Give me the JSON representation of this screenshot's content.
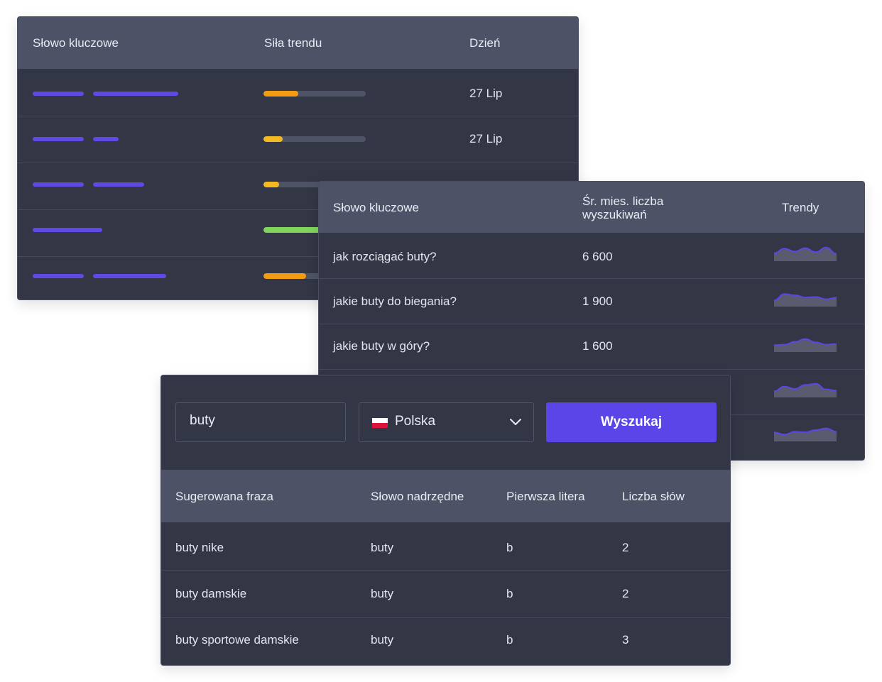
{
  "trend_table": {
    "headers": {
      "keyword": "Słowo kluczowe",
      "strength": "Siła trendu",
      "day": "Dzień"
    },
    "rows": [
      {
        "strength": 0.34,
        "color": "#f39c12",
        "day": "27 Lip"
      },
      {
        "strength": 0.19,
        "color": "#f5b921",
        "day": "27 Lip"
      },
      {
        "strength": 0.15,
        "color": "#f5b921",
        "day": ""
      },
      {
        "strength": 0.7,
        "color": "#7fd65a",
        "day": ""
      },
      {
        "strength": 0.42,
        "color": "#f39c12",
        "day": ""
      }
    ]
  },
  "volume_table": {
    "headers": {
      "keyword": "Słowo kluczowe",
      "volume_line1": "Śr. mies. liczba",
      "volume_line2": "wyszukiwań",
      "trends": "Trendy"
    },
    "rows": [
      {
        "keyword": "jak rozciągać buty?",
        "volume": "6 600",
        "trend": [
          0.45,
          0.85,
          0.6,
          0.9,
          0.55,
          0.95,
          0.4
        ]
      },
      {
        "keyword": "jakie buty do biegania?",
        "volume": "1 900",
        "trend": [
          0.3,
          0.85,
          0.75,
          0.55,
          0.6,
          0.4,
          0.55
        ]
      },
      {
        "keyword": "jakie buty w góry?",
        "volume": "1 600",
        "trend": [
          0.35,
          0.4,
          0.65,
          0.9,
          0.6,
          0.4,
          0.45
        ]
      },
      {
        "keyword": "",
        "volume": "",
        "trend": [
          0.3,
          0.7,
          0.5,
          0.85,
          0.95,
          0.45,
          0.35
        ]
      },
      {
        "keyword": "",
        "volume": "",
        "trend": [
          0.55,
          0.35,
          0.6,
          0.55,
          0.75,
          0.9,
          0.6
        ]
      }
    ]
  },
  "search": {
    "query": "buty",
    "country": "Polska",
    "button_label": "Wyszukaj"
  },
  "suggest_table": {
    "headers": {
      "phrase": "Sugerowana fraza",
      "parent": "Słowo nadrzędne",
      "first_letter": "Pierwsza litera",
      "word_count": "Liczba słów"
    },
    "rows": [
      {
        "phrase": "buty nike",
        "parent": "buty",
        "first_letter": "b",
        "word_count": "2"
      },
      {
        "phrase": "buty damskie",
        "parent": "buty",
        "first_letter": "b",
        "word_count": "2"
      },
      {
        "phrase": "buty sportowe damskie",
        "parent": "buty",
        "first_letter": "b",
        "word_count": "3"
      }
    ]
  },
  "colors": {
    "accent": "#5a46e8",
    "panel_bg": "#333645",
    "header_bg": "#4d5266"
  }
}
